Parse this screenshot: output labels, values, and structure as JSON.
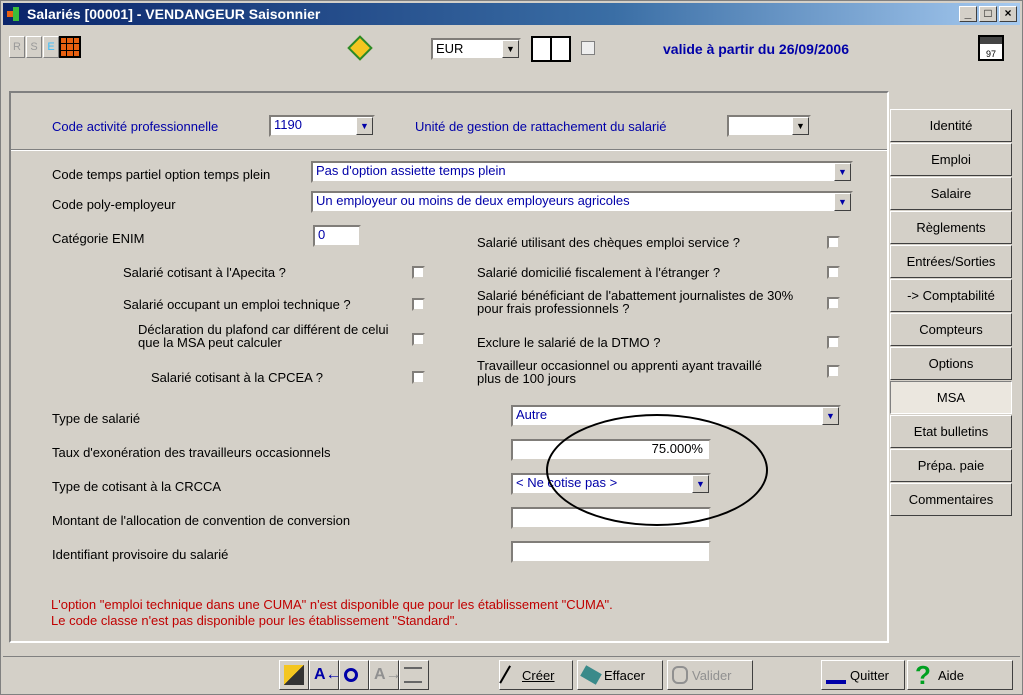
{
  "window": {
    "title": "Salariés [00001] - VENDANGEUR Saisonnier",
    "minimize": "_",
    "maximize": "□",
    "close": "×"
  },
  "toolbar": {
    "rse": [
      "R",
      "S",
      "E"
    ],
    "currency": "EUR",
    "valid_from": "valide à partir du 26/09/2006",
    "calendar_label": "97"
  },
  "form": {
    "code_activite_label": "Code activité professionnelle",
    "code_activite_value": "1190",
    "unite_gestion_label": "Unité de gestion de rattachement du salarié",
    "unite_gestion_value": "",
    "temps_partiel_label": "Code temps partiel option temps plein",
    "temps_partiel_value": "Pas d'option assiette temps plein",
    "poly_employeur_label": "Code poly-employeur",
    "poly_employeur_value": "Un employeur ou moins de deux employeurs agricoles",
    "categorie_enim_label": "Catégorie ENIM",
    "categorie_enim_value": "0",
    "left_checks": [
      "Salarié cotisant à l'Apecita ?",
      "Salarié occupant un emploi technique ?",
      "Déclaration du plafond car différent de celui que la MSA peut calculer",
      "Salarié cotisant à la CPCEA ?"
    ],
    "right_checks": [
      "Salarié utilisant des chèques emploi service ?",
      "Salarié domicilié fiscalement à l'étranger ?",
      "Salarié bénéficiant de l'abattement journalistes de 30% pour frais professionnels ?",
      "Exclure le salarié de la DTMO ?",
      "Travailleur occasionnel ou apprenti ayant travaillé plus de 100 jours"
    ],
    "type_salarie_label": "Type de salarié",
    "type_salarie_value": "Autre",
    "taux_exo_label": "Taux d'exonération des travailleurs occasionnels",
    "taux_exo_value": "75.000%",
    "type_cotisant_label": "Type de cotisant à la CRCCA",
    "type_cotisant_value": "< Ne cotise pas >",
    "montant_alloc_label": "Montant de l'allocation de convention de conversion",
    "montant_alloc_value": "",
    "identifiant_label": "Identifiant provisoire du salarié",
    "identifiant_value": "",
    "message_1": "L'option \"emploi technique dans une CUMA\" n'est disponible que pour les établissement \"CUMA\".",
    "message_2": "Le code classe n'est pas disponible pour les établissement \"Standard\"."
  },
  "tabs": [
    "Identité",
    "Emploi",
    "Salaire",
    "Règlements",
    "Entrées/Sorties",
    "-> Comptabilité",
    "Compteurs",
    "Options",
    "MSA",
    "Etat bulletins",
    "Prépa. paie",
    "Commentaires"
  ],
  "buttons": {
    "creer": "Créer",
    "effacer": "Effacer",
    "valider": "Valider",
    "quitter": "Quitter",
    "aide": "Aide"
  }
}
